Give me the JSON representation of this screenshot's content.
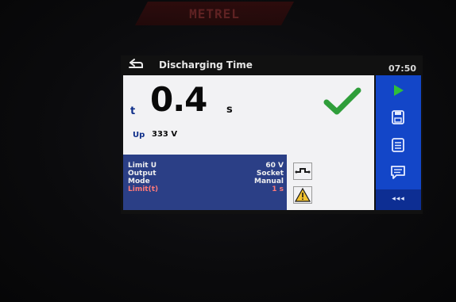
{
  "brand": {
    "text": "METREL"
  },
  "header": {
    "title": "Discharging Time",
    "clock": "07:50"
  },
  "result": {
    "symbol": "t",
    "value": "0.4",
    "unit": "s",
    "status_icon": "check-icon",
    "status_color": "#2f9e3a"
  },
  "secondary": {
    "label": "Up",
    "value": "333 V"
  },
  "params": {
    "rows": [
      {
        "label": "Limit U",
        "value": "60 V"
      },
      {
        "label": "Output",
        "value": "Socket"
      },
      {
        "label": "Mode",
        "value": "Manual"
      },
      {
        "label": "Limit(t)",
        "value": "1 s",
        "color": "#ff7a7a"
      }
    ]
  },
  "side_buttons": [
    "play-icon",
    "save-icon",
    "list-icon",
    "comment-icon"
  ],
  "side_collapse": "◂◂◂",
  "colors": {
    "accent": "#1346c8",
    "panel": "#2b3f86"
  }
}
